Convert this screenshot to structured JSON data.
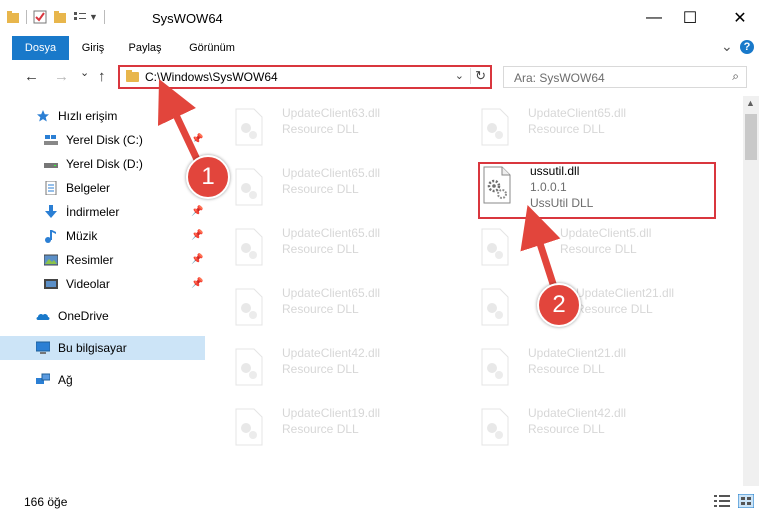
{
  "window": {
    "title": "SysWOW64",
    "minimize_glyph": "—",
    "maximize_glyph": "☐",
    "close_glyph": "✕"
  },
  "ribbon": {
    "tabs": [
      "Dosya",
      "Giriş",
      "Paylaş",
      "Görünüm"
    ],
    "active_tab": "Dosya",
    "expand_glyph": "⌄",
    "help_glyph": "?"
  },
  "nav": {
    "back_glyph": "←",
    "forward_glyph": "→",
    "recent_glyph": "⌄",
    "up_glyph": "↑",
    "address_path": "C:\\Windows\\SysWOW64",
    "address_dropdown_glyph": "⌄",
    "refresh_glyph": "↻",
    "search_placeholder": "Ara: SysWOW64",
    "search_icon_glyph": "⌕"
  },
  "sidebar": {
    "items": [
      {
        "label": "Hızlı erişim",
        "icon": "star-icon",
        "pinned": false
      },
      {
        "label": "Yerel Disk (C:)",
        "icon": "drive-c-icon",
        "pinned": true
      },
      {
        "label": "Yerel Disk (D:)",
        "icon": "drive-d-icon",
        "pinned": true
      },
      {
        "label": "Belgeler",
        "icon": "documents-icon",
        "pinned": true
      },
      {
        "label": "İndirmeler",
        "icon": "downloads-icon",
        "pinned": true
      },
      {
        "label": "Müzik",
        "icon": "music-icon",
        "pinned": true
      },
      {
        "label": "Resimler",
        "icon": "pictures-icon",
        "pinned": true
      },
      {
        "label": "Videolar",
        "icon": "videos-icon",
        "pinned": true
      },
      {
        "label": "OneDrive",
        "icon": "onedrive-icon",
        "pinned": false
      },
      {
        "label": "Bu bilgisayar",
        "icon": "this-pc-icon",
        "pinned": false,
        "selected": true
      },
      {
        "label": "Ağ",
        "icon": "network-icon",
        "pinned": false
      }
    ],
    "pin_glyph": "📌"
  },
  "files": {
    "left_column": [
      {
        "name": "UpdateClient63.dll",
        "desc": "Resource DLL"
      },
      {
        "name": "UpdateClient65.dll",
        "desc": "Resource DLL"
      },
      {
        "name": "UpdateClient65.dll",
        "desc": "Resource DLL"
      },
      {
        "name": "UpdateClient65.dll",
        "desc": "Resource DLL"
      },
      {
        "name": "UpdateClient42.dll",
        "desc": "Resource DLL"
      },
      {
        "name": "UpdateClient19.dll",
        "desc": "Resource DLL"
      }
    ],
    "right_column": [
      {
        "name": "UpdateClient65.dll",
        "desc": "Resource DLL"
      },
      {
        "name": "UpdateClient5.dll",
        "desc": "Resource DLL"
      },
      {
        "name": "UpdateClient21.dll",
        "desc": "Resource DLL"
      },
      {
        "name": "UpdateClient21.dll",
        "desc": "Resource DLL"
      },
      {
        "name": "UpdateClient42.dll",
        "desc": "Resource DLL"
      }
    ],
    "target": {
      "name": "ussutil.dll",
      "version": "1.0.0.1",
      "desc": "UssUtil DLL"
    }
  },
  "status": {
    "item_count": "166 öğe"
  },
  "annotations": {
    "step1": "1",
    "step2": "2",
    "accent_color": "#e2453c"
  }
}
